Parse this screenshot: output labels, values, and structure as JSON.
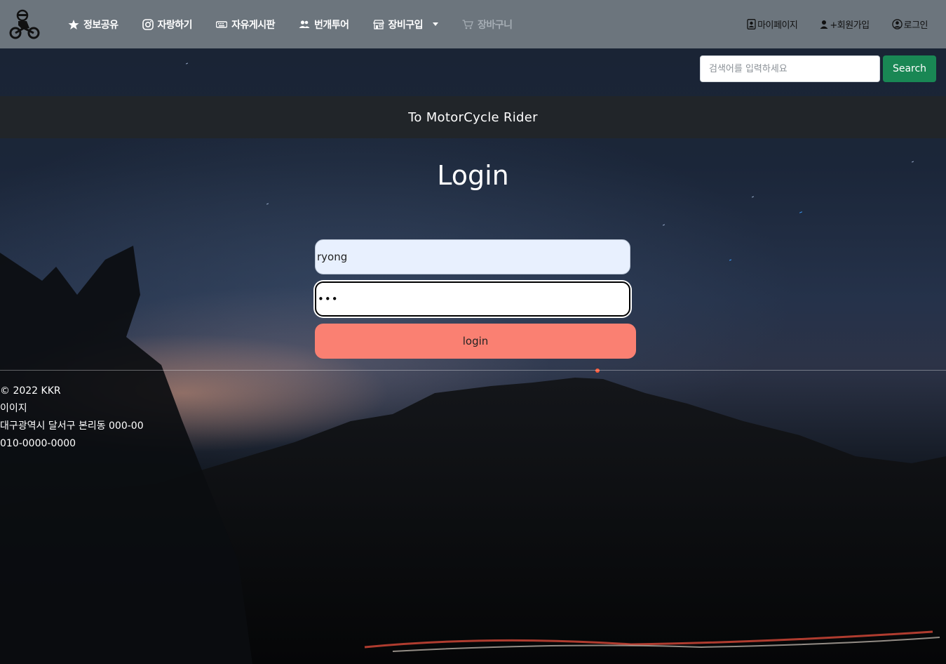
{
  "navbar": {
    "logo_icon": "motorcycle-rider-icon",
    "items": [
      {
        "label": "정보공유",
        "icon": "star-icon"
      },
      {
        "label": "자랑하기",
        "icon": "instagram-icon"
      },
      {
        "label": "자유게시판",
        "icon": "keyboard-icon"
      },
      {
        "label": "번개투어",
        "icon": "people-icon"
      },
      {
        "label": "장비구입",
        "icon": "shop-icon"
      },
      {
        "label": "장바구니",
        "icon": "cart-icon",
        "disabled": true
      }
    ],
    "right_items": [
      {
        "label": "마이페이지",
        "icon": "person-badge-icon"
      },
      {
        "label": "+회원가입",
        "icon": "person-plus-icon"
      },
      {
        "label": "로그인",
        "icon": "person-circle-icon"
      }
    ]
  },
  "search": {
    "placeholder": "검색어를 입력하세요",
    "button_label": "Search"
  },
  "header": {
    "title": "To MotorCycle Rider"
  },
  "login": {
    "title": "Login",
    "username_value": "ryong",
    "password_value": "•••",
    "button_label": "login"
  },
  "footer": {
    "copyright": "© 2022 KKR",
    "name": "이이지",
    "address": "대구광역시 달서구 본리동 000-00",
    "phone": "010-0000-0000"
  },
  "colors": {
    "navbar": "#6c757d",
    "header": "#212529",
    "search_button": "#198754",
    "login_button": "#fa8072",
    "username_autofill": "#e8f0fe"
  }
}
